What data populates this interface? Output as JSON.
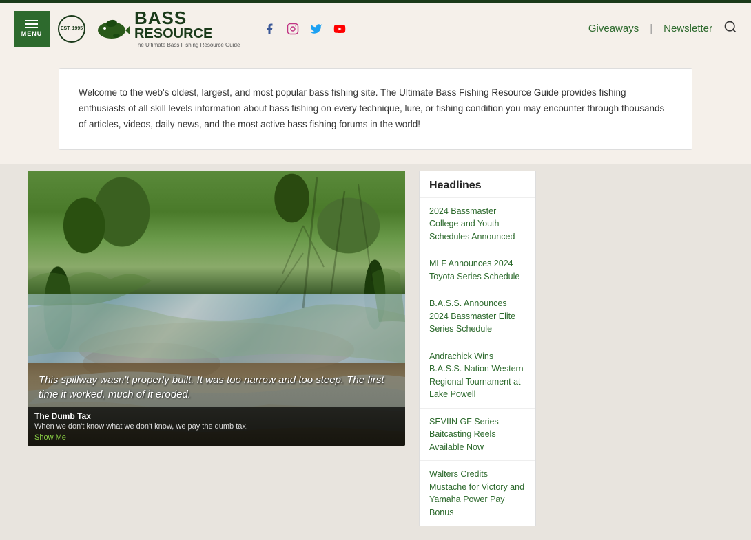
{
  "topbar": {},
  "header": {
    "menu_label": "MENU",
    "logo_bass": "BASS",
    "logo_resource": "RESOURCE",
    "logo_tagline": "The Ultimate Bass Fishing Resource Guide",
    "logo_est": "EST. 1995",
    "social": {
      "facebook_label": "f",
      "instagram_label": "📷",
      "twitter_label": "🐦",
      "youtube_label": "▶"
    },
    "nav": {
      "giveaways": "Giveaways",
      "newsletter": "Newsletter"
    }
  },
  "welcome": {
    "text": "Welcome to the web's oldest, largest, and most popular bass fishing site. The Ultimate Bass Fishing Resource Guide provides fishing enthusiasts of all skill levels information about bass fishing on every technique, lure, or fishing condition you may encounter through thousands of articles, videos, daily news, and the most active bass fishing forums in the world!"
  },
  "video": {
    "caption": "This spillway wasn't properly built. It was too narrow and too steep. The first time it worked, much of it eroded.",
    "title": "The Dumb Tax",
    "subtitle": "When we don't know what we don't know, we pay the dumb tax.",
    "show_me": "Show Me"
  },
  "headlines": {
    "title": "Headlines",
    "items": [
      {
        "text": "2024 Bassmaster College and Youth Schedules Announced"
      },
      {
        "text": "MLF Announces 2024 Toyota Series Schedule"
      },
      {
        "text": "B.A.S.S. Announces 2024 Bassmaster Elite Series Schedule"
      },
      {
        "text": "Andrachick Wins B.A.S.S. Nation Western Regional Tournament at Lake Powell"
      },
      {
        "text": "SEVIIN GF Series Baitcasting Reels Available Now"
      },
      {
        "text": "Walters Credits Mustache for Victory and Yamaha Power Pay Bonus"
      }
    ]
  }
}
